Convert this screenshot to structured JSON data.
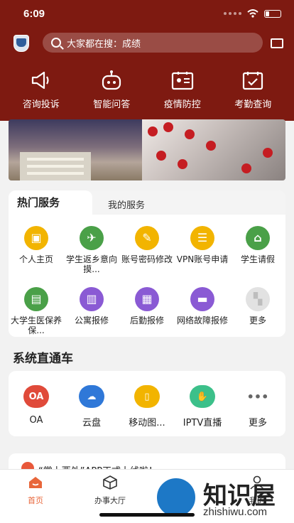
{
  "status": {
    "time": "6:09"
  },
  "search": {
    "placeholder": "大家都在搜：成绩"
  },
  "quick_actions": [
    {
      "label": "咨询投诉",
      "icon": "megaphone-icon"
    },
    {
      "label": "智能问答",
      "icon": "robot-icon"
    },
    {
      "label": "疫情防控",
      "icon": "id-card-icon"
    },
    {
      "label": "考勤查询",
      "icon": "calendar-check-icon"
    }
  ],
  "services": {
    "tabs": [
      "热门服务",
      "我的服务"
    ],
    "items": [
      {
        "label": "个人主页",
        "color": "#f2b400",
        "icon": "person-badge-icon"
      },
      {
        "label": "学生返乡意向摸...",
        "color": "#4aa048",
        "icon": "airplane-icon"
      },
      {
        "label": "账号密码修改",
        "color": "#f2b400",
        "icon": "edit-document-icon"
      },
      {
        "label": "VPN账号申请",
        "color": "#f2b400",
        "icon": "vpn-form-icon"
      },
      {
        "label": "学生请假",
        "color": "#4aa048",
        "icon": "house-leave-icon"
      },
      {
        "label": "大学生医保养保...",
        "color": "#4aa048",
        "icon": "medical-card-icon"
      },
      {
        "label": "公寓报修",
        "color": "#8a5ad4",
        "icon": "building-icon"
      },
      {
        "label": "后勤报修",
        "color": "#8a5ad4",
        "icon": "clipboard-icon"
      },
      {
        "label": "网络故障报修",
        "color": "#8a5ad4",
        "icon": "router-icon"
      },
      {
        "label": "更多",
        "color": "#d9d9d9",
        "icon": "grid-more-icon"
      }
    ]
  },
  "systems": {
    "title": "系统直通车",
    "items": [
      {
        "label": "OA",
        "badge": "OA",
        "color": "#e04a3a",
        "icon": "oa-icon"
      },
      {
        "label": "云盘",
        "badge": "",
        "color": "#2f78d8",
        "icon": "cloud-icon"
      },
      {
        "label": "移动图...",
        "badge": "",
        "color": "#f2b400",
        "icon": "book-icon"
      },
      {
        "label": "IPTV直播",
        "badge": "",
        "color": "#3cc08a",
        "icon": "handshake-icon"
      },
      {
        "label": "更多",
        "badge": "•••",
        "color": "#ffffff",
        "icon": "more-dots-icon"
      }
    ]
  },
  "news": {
    "text": "“掌上西外”APP正式上线啦！"
  },
  "tabbar": [
    {
      "label": "首页",
      "active": true
    },
    {
      "label": "办事大厅",
      "active": false
    },
    {
      "label": "我的",
      "active": false
    }
  ],
  "watermark": {
    "text": "知识屋",
    "url": "zhishiwu.com"
  }
}
